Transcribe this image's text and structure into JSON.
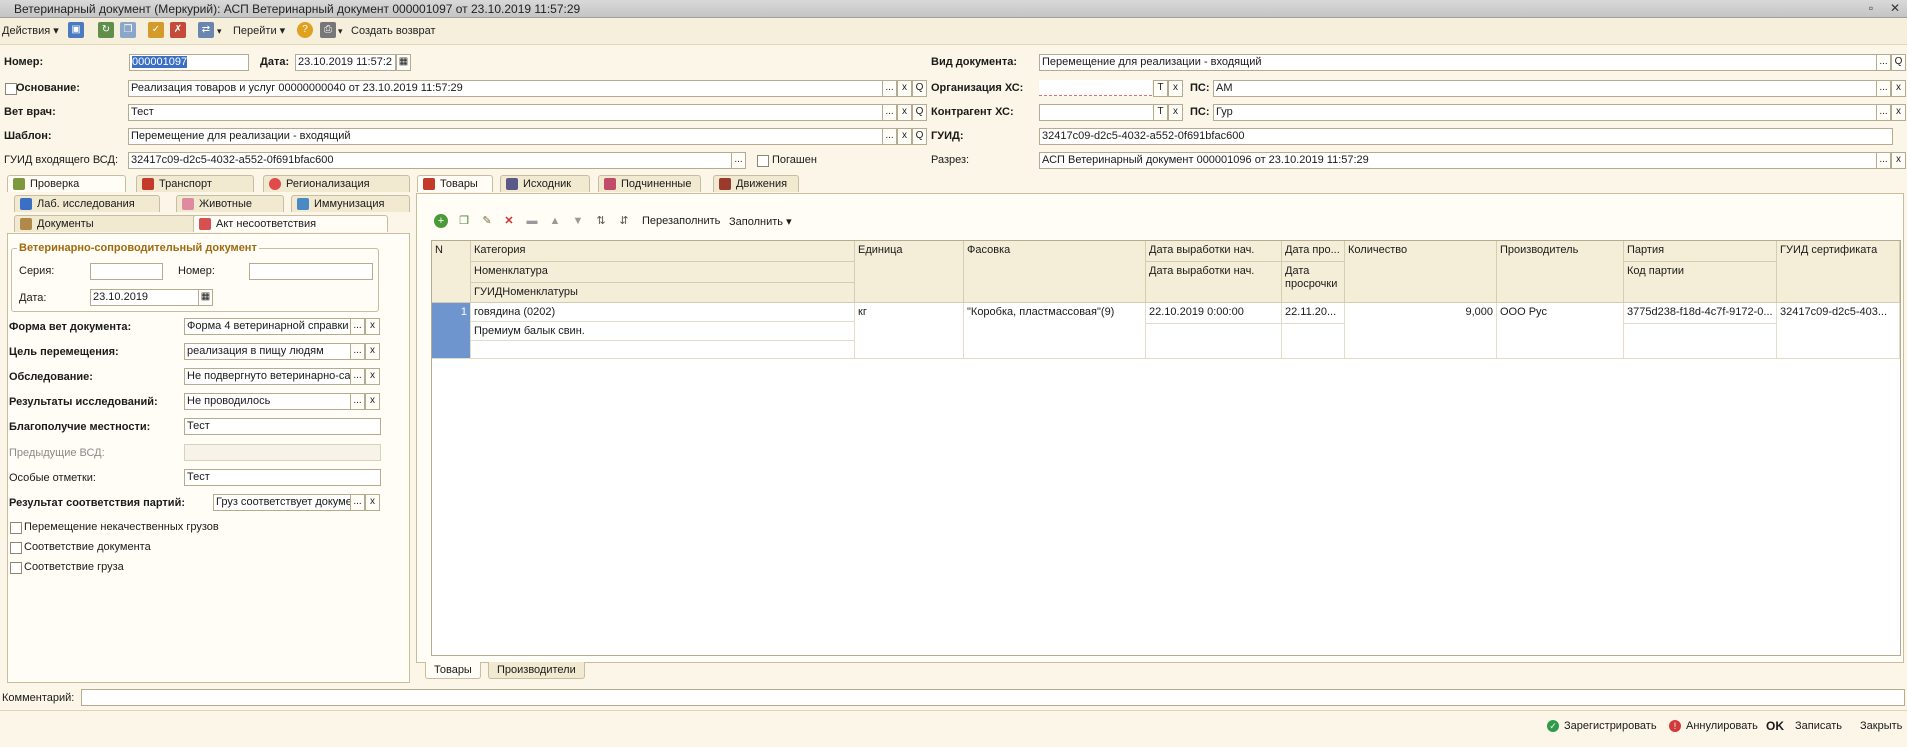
{
  "window": {
    "title": "Ветеринарный документ (Меркурий): АСП Ветеринарный документ 000001097 от 23.10.2019 11:57:29"
  },
  "toolbar": {
    "actions": "Действия",
    "goto": "Перейти",
    "create_return": "Создать возврат"
  },
  "header": {
    "number_label": "Номер:",
    "number_value": "000001097",
    "date_label": "Дата:",
    "date_value": "23.10.2019 11:57:2",
    "basis_label": "Основание:",
    "basis_value": "Реализация товаров и услуг 00000000040 от 23.10.2019 11:57:29",
    "vet_label": "Вет врач:",
    "vet_value": "Тест",
    "template_label": "Шаблон:",
    "template_value": "Перемещение для реализации - входящий",
    "guid_in_label": "ГУИД входящего ВСД:",
    "guid_in_value": "32417c09-d2c5-4032-a552-0f691bfac600",
    "repaid_label": "Погашен",
    "doctype_label": "Вид документа:",
    "doctype_value": "Перемещение для реализации - входящий",
    "org_label": "Организация ХС:",
    "org_value": "",
    "ps_label": "ПС:",
    "ps1_value": "АМ",
    "ps2_value": "Гур",
    "contractor_label": "Контрагент ХС:",
    "contractor_value": "",
    "guid_label": "ГУИД:",
    "guid_value": "32417c09-d2c5-4032-a552-0f691bfac600",
    "section_label": "Разрез:",
    "section_value": "АСП Ветеринарный документ 000001096 от 23.10.2019 11:57:29",
    "t_btn": "T",
    "x_btn": "x",
    "dots_btn": "...",
    "q_btn": "Q"
  },
  "left_tabs": {
    "row1": [
      "Проверка",
      "Транспорт",
      "Регионализация"
    ],
    "row2": [
      "Лаб. исследования",
      "Животные",
      "Иммунизация"
    ],
    "row3": [
      "Документы",
      "Акт несоответствия"
    ]
  },
  "vsd": {
    "group_title": "Ветеринарно-сопроводительный документ",
    "series_label": "Серия:",
    "number_label": "Номер:",
    "date_label": "Дата:",
    "date_value": "23.10.2019"
  },
  "form": {
    "form_label": "Форма вет документа:",
    "form_value": "Форма 4 ветеринарной справки",
    "purpose_label": "Цель перемещения:",
    "purpose_value": "реализация в пищу людям",
    "inspection_label": "Обследование:",
    "inspection_value": "Не подвергнуто ветеринарно-санитарному",
    "results_label": "Результаты исследований:",
    "results_value": "Не проводилось",
    "wellbeing_label": "Благополучие местности:",
    "wellbeing_value": "Тест",
    "prev_label": "Предыдущие ВСД:",
    "prev_value": "",
    "notes_label": "Особые отметки:",
    "notes_value": "Тест",
    "match_label": "Результат соответствия партий:",
    "match_value": "Груз соответствует документам",
    "cb1": "Перемещение некачественных грузов",
    "cb2": "Соответствие документа",
    "cb3": "Соответствие груза"
  },
  "right_tabs": [
    "Товары",
    "Исходник",
    "Подчиненные",
    "Движения"
  ],
  "grid_toolbar": {
    "refill": "Перезаполнить",
    "fill": "Заполнить"
  },
  "grid": {
    "headers": {
      "n": "N",
      "category": "Категория",
      "nomenclature": "Номенклатура",
      "guid_nom": "ГУИДНоменклатуры",
      "unit": "Единица",
      "packing": "Фасовка",
      "prod_date": "Дата выработки нач.",
      "prod_date2": "Дата выработки нач.",
      "exp": "Дата про...",
      "exp2": "Дата просрочки",
      "qty": "Количество",
      "producer": "Производитель",
      "batch": "Партия",
      "batch_code": "Код партии",
      "cert": "ГУИД сертификата"
    },
    "row": {
      "n": "1",
      "category": "говядина (0202)",
      "nomenclature": "Премиум балык свин.",
      "unit": "кг",
      "packing": "\"Коробка, пластмассовая\"(9)",
      "prod_date": "22.10.2019 0:00:00",
      "exp": "22.11.20...",
      "qty": "9,000",
      "producer": "ООО Рус",
      "batch": "3775d238-f18d-4c7f-9172-0...",
      "cert": "32417c09-d2c5-403..."
    }
  },
  "bottom_tabs": [
    "Товары",
    "Производители"
  ],
  "comment_label": "Комментарий:",
  "footer": {
    "register": "Зарегистрировать",
    "annul": "Аннулировать",
    "ok": "OK",
    "save": "Записать",
    "close": "Закрыть"
  },
  "colors": {
    "accent": "#3a6fc4",
    "bg": "#fbf6e7"
  }
}
